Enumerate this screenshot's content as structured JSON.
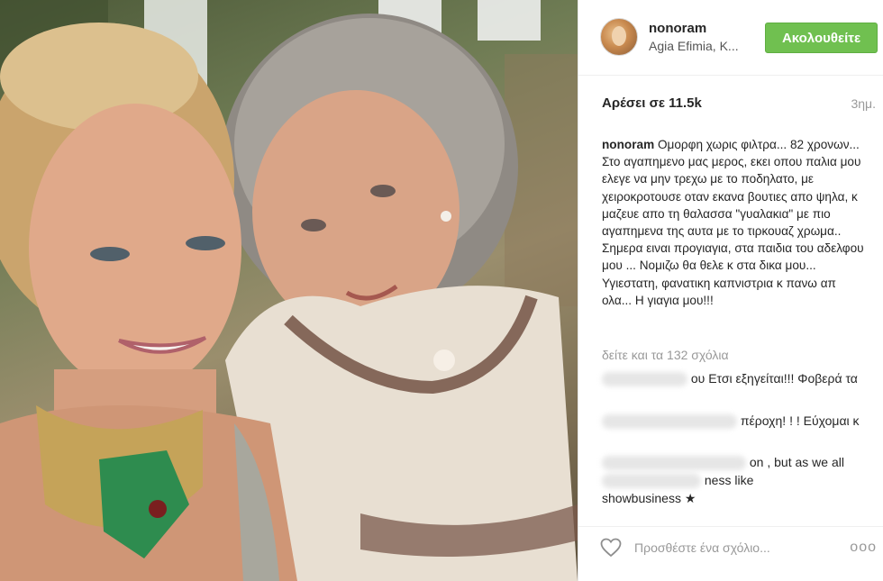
{
  "photo": {
    "alt_icon": "photo-image"
  },
  "header": {
    "username": "nonoram",
    "location": "Agia Efimia, K...",
    "follow_label": "Ακολουθείτε",
    "follow_color": "#70c050"
  },
  "stats": {
    "likes": "Αρέσει σε 11.5k",
    "time": "3ημ."
  },
  "caption": {
    "author": "nonoram",
    "text": "Ομορφη χωρις φιλτρα... 82 χρονων... Στο αγαπημενο μας μερος, εκει οπου παλια μου ελεγε να μην τρεχω με το ποδηλατο, με χειροκροτουσε οταν εκανα βουτιες απο ψηλα, κ μαζευε απο τη θαλασσα \"γυαλακια\" με πιο αγαπημενα της αυτα με το τιρκουαζ χρωμα.. Σημερα ειναι προγιαγια, στα παιδια του αδελφου μου ... Νομιζω θα θελε κ στα δικα μου... Υγιεστατη, φανατικη καπνιστρια κ πανω απ ολα... Η γιαγια μου!!!"
  },
  "comments": {
    "view_all": "δείτε και τα 132 σχόλια",
    "items": [
      {
        "text": "ου Ετσι εξηγείται!!! Φοβερά τα"
      },
      {
        "text": "πέροχη! ! ! Εύχομαι κ"
      },
      {
        "line1": "on , but as we all",
        "line2": "ness like",
        "line3": "showbusiness ★"
      }
    ]
  },
  "footer": {
    "placeholder": "Προσθέστε ένα σχόλιο...",
    "more": "ooo",
    "heart_icon": "heart-outline-icon"
  }
}
